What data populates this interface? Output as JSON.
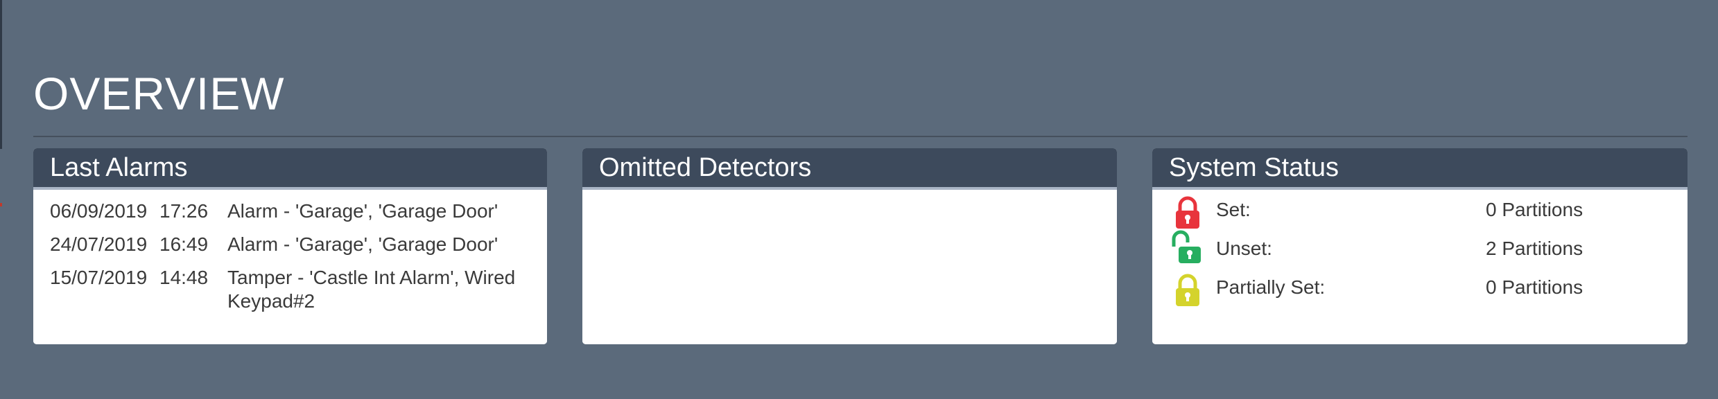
{
  "page": {
    "title": "OVERVIEW"
  },
  "last_alarms": {
    "title": "Last Alarms",
    "rows": [
      {
        "date": "06/09/2019",
        "time": "17:26",
        "description": "Alarm - 'Garage', 'Garage Door'"
      },
      {
        "date": "24/07/2019",
        "time": "16:49",
        "description": "Alarm - 'Garage', 'Garage Door'"
      },
      {
        "date": "15/07/2019",
        "time": "14:48",
        "description": "Tamper - 'Castle Int Alarm', Wired Keypad#2"
      }
    ]
  },
  "omitted_detectors": {
    "title": "Omitted Detectors"
  },
  "system_status": {
    "title": "System Status",
    "rows": [
      {
        "label": "Set:",
        "value": "0 Partitions",
        "icon": "lock-closed-icon",
        "color": "#e8343c"
      },
      {
        "label": "Unset:",
        "value": "2 Partitions",
        "icon": "lock-open-icon",
        "color": "#27ae60"
      },
      {
        "label": "Partially Set:",
        "value": "0 Partitions",
        "icon": "lock-partial-icon",
        "color": "#d4d32c"
      }
    ]
  },
  "colors": {
    "background": "#5b6a7b",
    "panel_header": "#3d4a5c",
    "panel_header_underline": "#a9b5c6",
    "text": "#3a3a3a"
  }
}
